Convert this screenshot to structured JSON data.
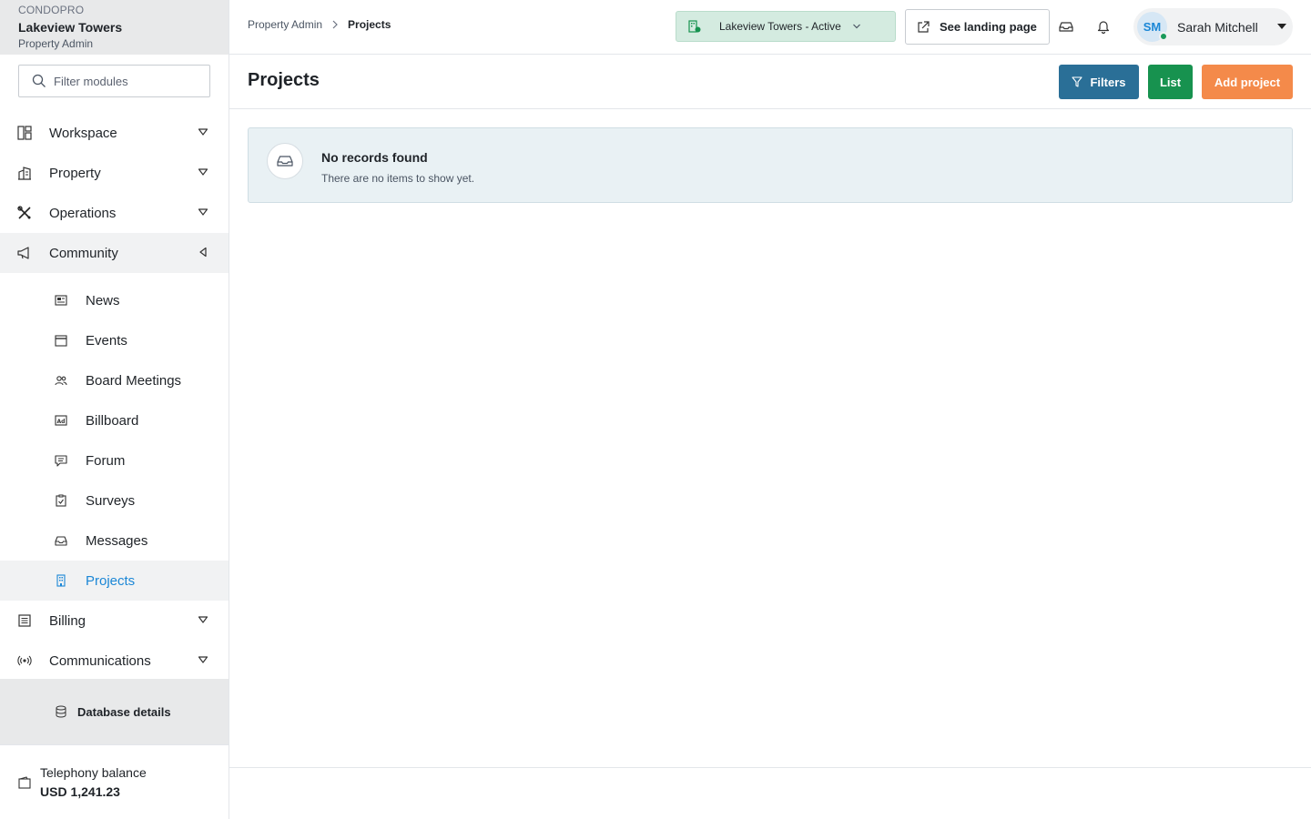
{
  "brand": {
    "org": "CONDOPRO",
    "property": "Lakeview Towers",
    "role": "Property Admin"
  },
  "sidebar": {
    "filter_placeholder": "Filter modules",
    "items": [
      {
        "label": "Workspace",
        "icon": "layout-icon",
        "state": "collapsed"
      },
      {
        "label": "Property",
        "icon": "building-icon",
        "state": "collapsed"
      },
      {
        "label": "Operations",
        "icon": "tools-icon",
        "state": "collapsed"
      },
      {
        "label": "Community",
        "icon": "megaphone-icon",
        "state": "expanded"
      },
      {
        "label": "Billing",
        "icon": "receipt-icon",
        "state": "collapsed"
      },
      {
        "label": "Communications",
        "icon": "broadcast-icon",
        "state": "collapsed"
      }
    ],
    "community_sub": [
      {
        "label": "News",
        "icon": "newspaper-icon"
      },
      {
        "label": "Events",
        "icon": "calendar-icon"
      },
      {
        "label": "Board Meetings",
        "icon": "people-icon"
      },
      {
        "label": "Billboard",
        "icon": "ad-icon"
      },
      {
        "label": "Forum",
        "icon": "chat-icon"
      },
      {
        "label": "Surveys",
        "icon": "clipboard-icon"
      },
      {
        "label": "Messages",
        "icon": "inbox-icon"
      },
      {
        "label": "Projects",
        "icon": "building-icon",
        "active": true
      }
    ],
    "database_label": "Database details",
    "balance_label": "Telephony balance",
    "balance_value": "USD 1,241.23"
  },
  "topbar": {
    "breadcrumb_root": "Property Admin",
    "breadcrumb_current": "Projects",
    "property_select": "Lakeview Towers - Active",
    "landing_label": "See landing page",
    "user_initials": "SM",
    "user_name": "Sarah Mitchell"
  },
  "page": {
    "title": "Projects",
    "filters_label": "Filters",
    "list_label": "List",
    "add_label": "Add project",
    "empty_title": "No records found",
    "empty_message": "There are no items to show yet."
  },
  "colors": {
    "accent_blue": "#1b87d6",
    "filters_button": "#2a6f97",
    "list_button": "#17924f",
    "add_button": "#f48a4a",
    "status_green": "#1a9a5a"
  }
}
